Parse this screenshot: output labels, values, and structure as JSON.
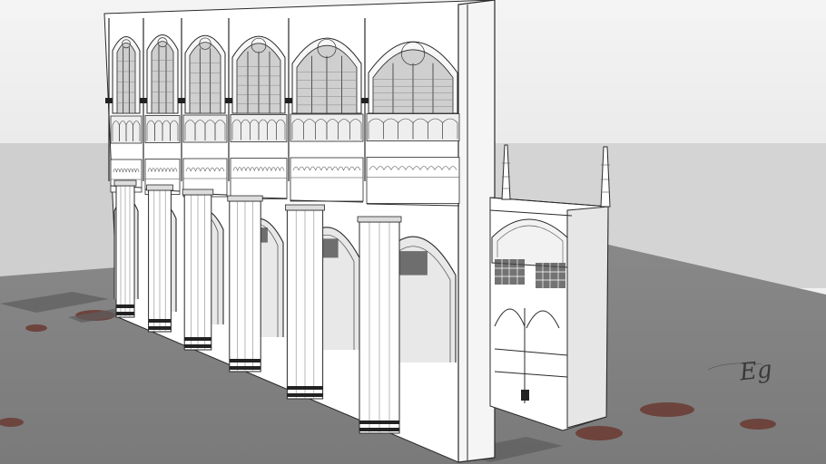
{
  "scene": {
    "subject": "sketchup-gothic-nave-arcade-model",
    "colors": {
      "sky": "#e9e9e9",
      "ground": "#838383",
      "ground_dark": "#6c6c6c",
      "stone": "#ffffff",
      "shade": "#d9d9d9",
      "line": "#2a2a2a",
      "stain": "#6b3a32"
    },
    "ground_inscription": "Eg"
  }
}
